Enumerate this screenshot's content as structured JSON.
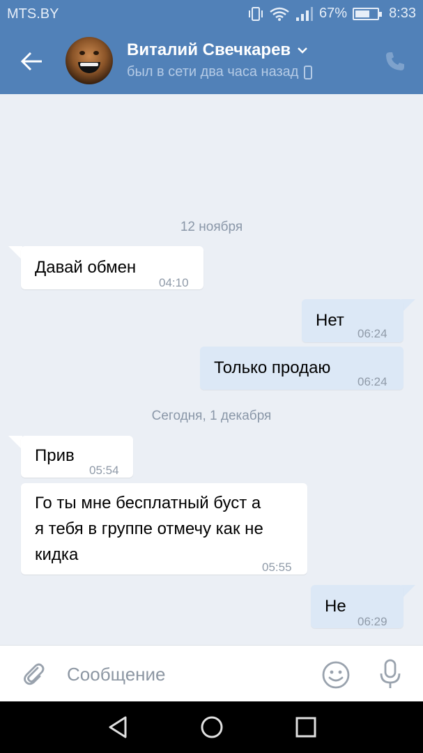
{
  "status_bar": {
    "carrier": "MTS.BY",
    "battery": "67%",
    "battery_level": 0.67,
    "time": "8:33"
  },
  "header": {
    "contact_name": "Виталий Свечкарев",
    "contact_status": "был в сети два часа назад",
    "icons": [
      "back-arrow-icon",
      "chevron-down-icon",
      "mobile-phone-icon",
      "phone-call-icon"
    ]
  },
  "chat": {
    "date_1": "12 ноября",
    "date_2": "Сегодня, 1 декабря",
    "messages": [
      {
        "dir": "in",
        "text": "Давай обмен",
        "time": "04:10"
      },
      {
        "dir": "out",
        "text": "Нет",
        "time": "06:24"
      },
      {
        "dir": "out",
        "text": "Только продаю",
        "time": "06:24"
      },
      {
        "dir": "in",
        "text": "Прив",
        "time": "05:54"
      },
      {
        "dir": "in",
        "lines": [
          "Го ты мне бесплатный буст а",
          "я тебя в группе отмечу как не",
          "кидка"
        ],
        "time": "05:55"
      },
      {
        "dir": "out",
        "text": "Не",
        "time": "06:29"
      }
    ]
  },
  "composer": {
    "placeholder": "Сообщение",
    "value": "",
    "icons": [
      "paperclip-icon",
      "smiley-icon",
      "microphone-icon"
    ]
  },
  "nav": {
    "icons": [
      "back-triangle-icon",
      "home-circle-icon",
      "recents-square-icon"
    ]
  },
  "colors": {
    "header_bg": "#5181b8",
    "chat_bg": "#ebeff5",
    "incoming_bubble": "#ffffff",
    "outgoing_bubble": "#dce8f6"
  }
}
